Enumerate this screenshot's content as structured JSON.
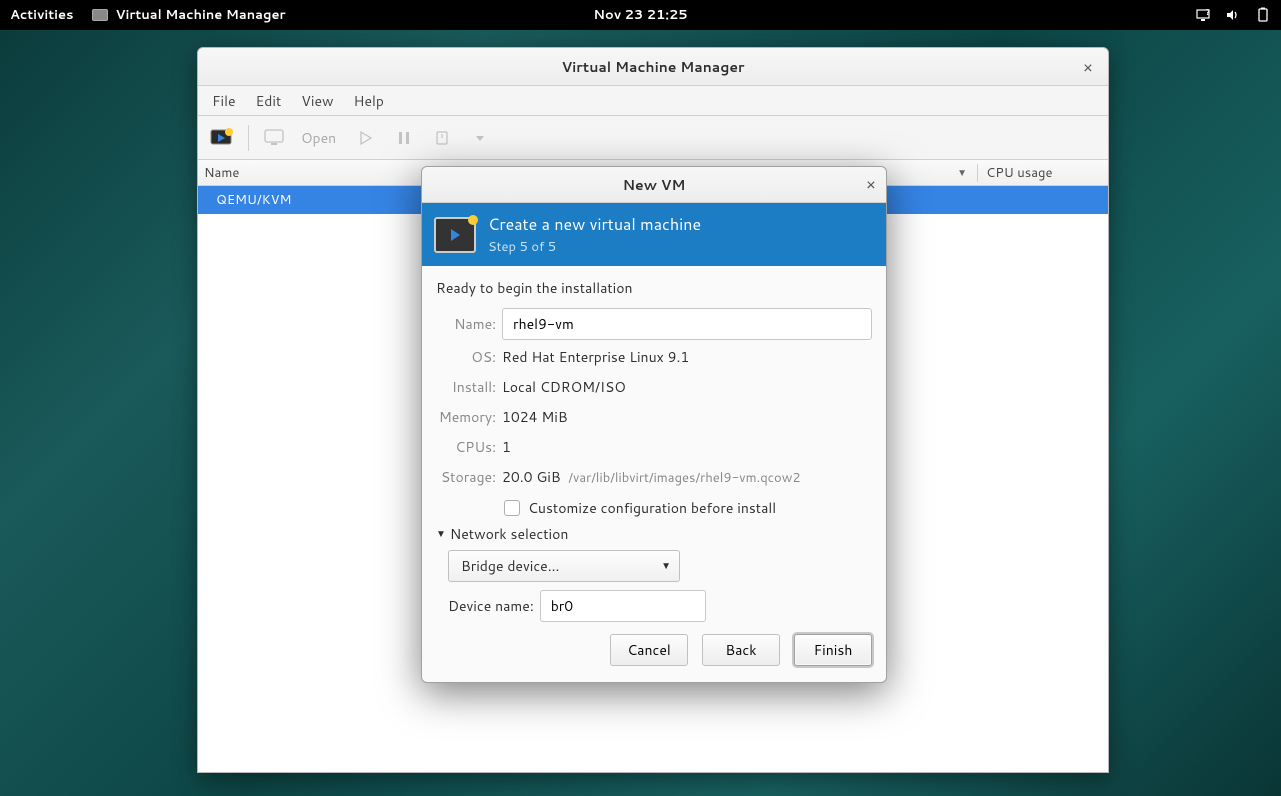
{
  "topbar": {
    "activities": "Activities",
    "app_name": "Virtual Machine Manager",
    "clock": "Nov 23  21:25"
  },
  "main_window": {
    "title": "Virtual Machine Manager",
    "menus": {
      "file": "File",
      "edit": "Edit",
      "view": "View",
      "help": "Help"
    },
    "toolbar": {
      "open": "Open"
    },
    "columns": {
      "name": "Name",
      "cpu": "CPU usage"
    },
    "rows": [
      {
        "label": "QEMU/KVM"
      }
    ]
  },
  "dialog": {
    "title": "New VM",
    "header": {
      "title": "Create a new virtual machine",
      "step": "Step 5 of 5"
    },
    "ready": "Ready to begin the installation",
    "fields": {
      "name_label": "Name:",
      "name_value": "rhel9-vm",
      "os_label": "OS:",
      "os_value": "Red Hat Enterprise Linux 9.1",
      "install_label": "Install:",
      "install_value": "Local CDROM/ISO",
      "memory_label": "Memory:",
      "memory_value": "1024 MiB",
      "cpus_label": "CPUs:",
      "cpus_value": "1",
      "storage_label": "Storage:",
      "storage_value": "20.0 GiB",
      "storage_path": "/var/lib/libvirt/images/rhel9-vm.qcow2"
    },
    "customize": "Customize configuration before install",
    "network": {
      "label": "Network selection",
      "combo": "Bridge device...",
      "device_label": "Device name:",
      "device_value": "br0"
    },
    "buttons": {
      "cancel": "Cancel",
      "back": "Back",
      "finish": "Finish"
    }
  }
}
